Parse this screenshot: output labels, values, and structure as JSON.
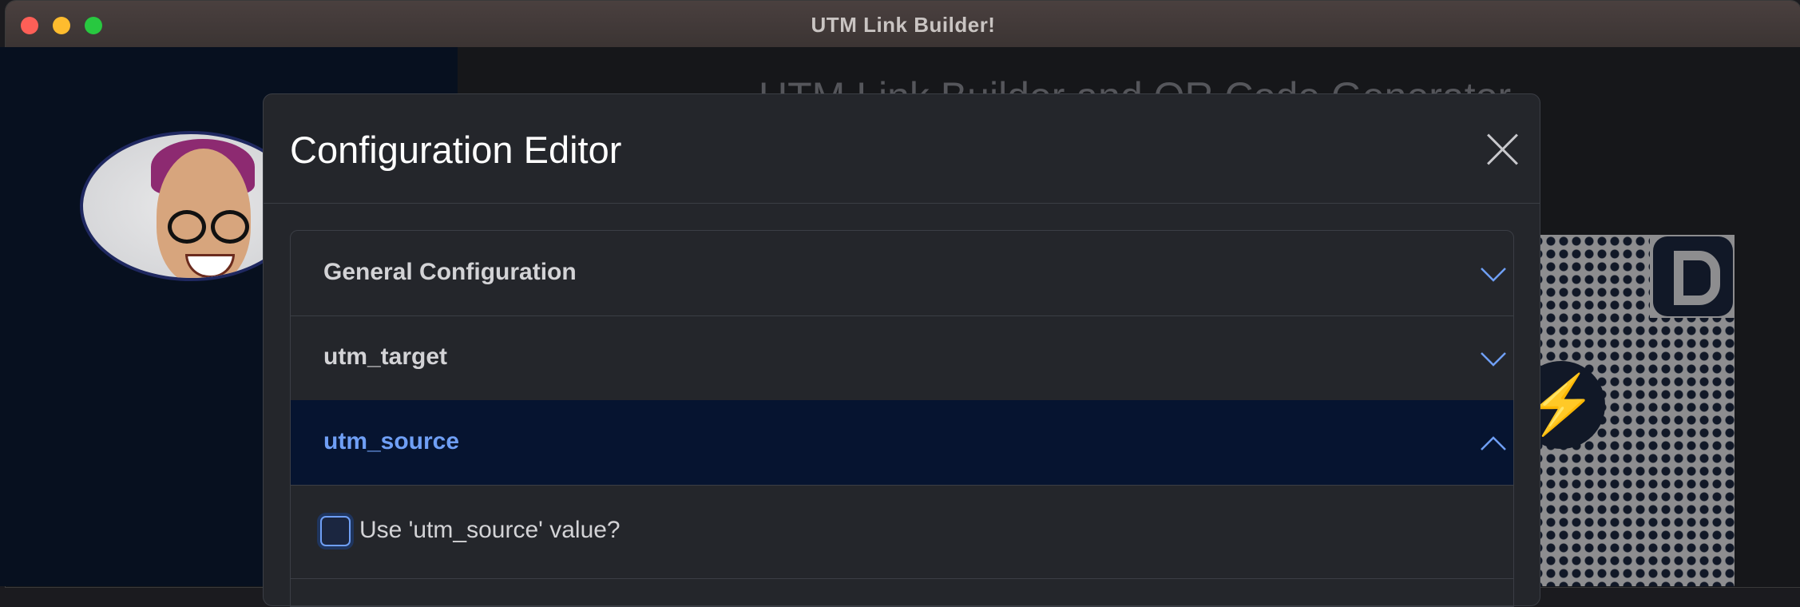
{
  "window": {
    "title": "UTM Link Builder!"
  },
  "main": {
    "title": "UTM Link Builder and QR Code Generator"
  },
  "modal": {
    "title": "Configuration Editor",
    "sections": [
      {
        "label": "General Configuration",
        "expanded": false
      },
      {
        "label": "utm_target",
        "expanded": false
      },
      {
        "label": "utm_source",
        "expanded": true
      }
    ],
    "utm_source_checkbox_label": "Use 'utm_source' value?",
    "utm_source_checkbox_checked": false
  },
  "colors": {
    "accent": "#6f9ff5",
    "modal_bg": "#24262b",
    "active_section_bg": "#061430",
    "sidebar_bg": "#07101f"
  },
  "icons": {
    "close": "close-icon",
    "collapse": "chevron-down-icon",
    "expand": "chevron-up-icon",
    "qr_center": "lightning-icon",
    "qr_corner": "d-logo-icon"
  }
}
